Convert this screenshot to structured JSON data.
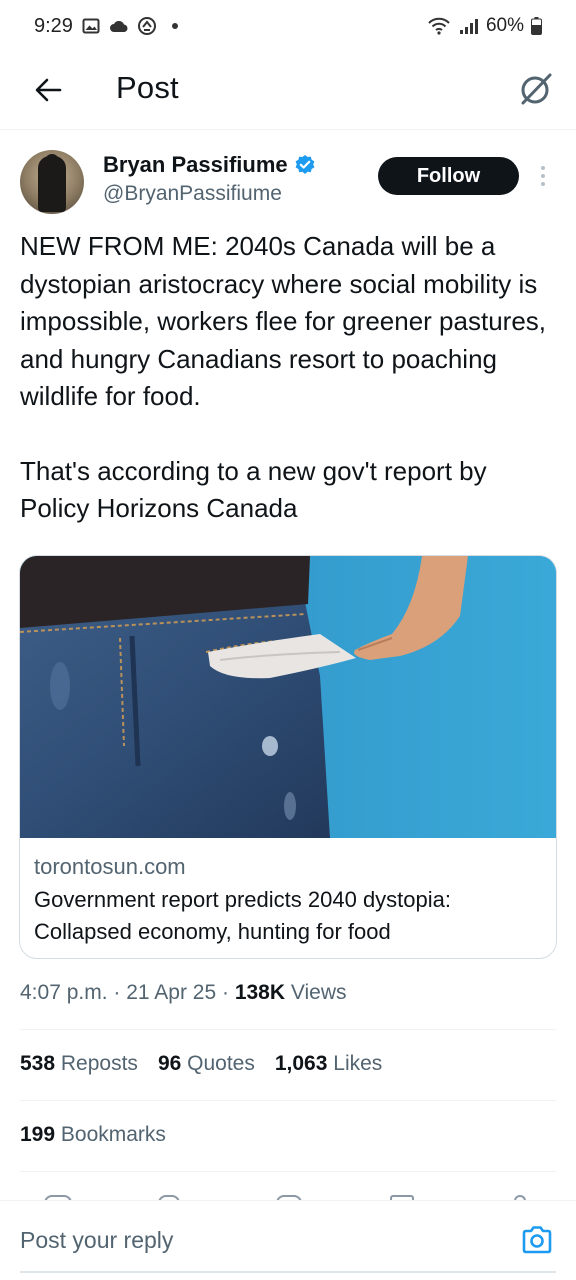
{
  "status_bar": {
    "time": "9:29",
    "battery": "60%",
    "icons": [
      "gallery-icon",
      "cloud-icon",
      "sync-icon",
      "dot-icon",
      "wifi-icon",
      "signal-icon",
      "battery-icon"
    ]
  },
  "header": {
    "title": "Post",
    "back_icon": "arrow-left-icon",
    "grok_icon": "grok-icon"
  },
  "author": {
    "name": "Bryan Passifiume",
    "handle": "@BryanPassifiume",
    "verified": true,
    "follow_label": "Follow"
  },
  "tweet": {
    "paragraphs": [
      "NEW FROM ME: 2040s Canada will be a dystopian aristocracy where social mobility is impossible, workers flee for greener pastures, and hungry Canadians resort to poaching wildlife for food.",
      "That's according to a new gov't report by Policy Horizons Canada"
    ]
  },
  "card": {
    "domain": "torontosun.com",
    "title": "Government report predicts 2040 dystopia: Collapsed economy, hunting for food"
  },
  "meta": {
    "time": "4:07 p.m.",
    "date": "21 Apr 25",
    "views_count": "138K",
    "views_label": "Views"
  },
  "stats": {
    "reposts_count": "538",
    "reposts_label": "Reposts",
    "quotes_count": "96",
    "quotes_label": "Quotes",
    "likes_count": "1,063",
    "likes_label": "Likes",
    "bookmarks_count": "199",
    "bookmarks_label": "Bookmarks"
  },
  "reply": {
    "placeholder": "Post your reply",
    "camera_icon": "camera-icon"
  },
  "colors": {
    "primary_text": "#0f1419",
    "secondary_text": "#536471",
    "verified_blue": "#1d9bf0",
    "camera_blue": "#1d9bf0",
    "follow_bg": "#0f1419"
  }
}
